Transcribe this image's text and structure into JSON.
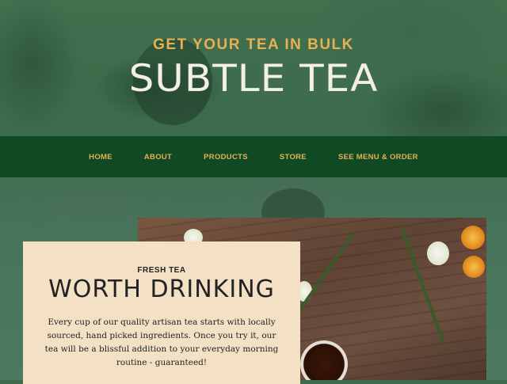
{
  "header": {
    "subtitle": "GET YOUR TEA IN BULK",
    "title": "SUBTLE TEA"
  },
  "nav": {
    "items": [
      {
        "label": "HOME"
      },
      {
        "label": "ABOUT"
      },
      {
        "label": "PRODUCTS"
      },
      {
        "label": "STORE"
      },
      {
        "label": "SEE MENU & ORDER"
      }
    ]
  },
  "intro": {
    "kicker": "FRESH TEA",
    "title": "WORTH DRINKING",
    "body": "Every cup of our quality artisan tea starts with locally sourced, hand picked ingredients. Once you try it, our tea will be a blissful addition to your everyday morning routine - guaranteed!"
  },
  "colors": {
    "nav_bg": "#0f4a25",
    "accent": "#e7b053",
    "card_bg": "#f4e1c5"
  }
}
